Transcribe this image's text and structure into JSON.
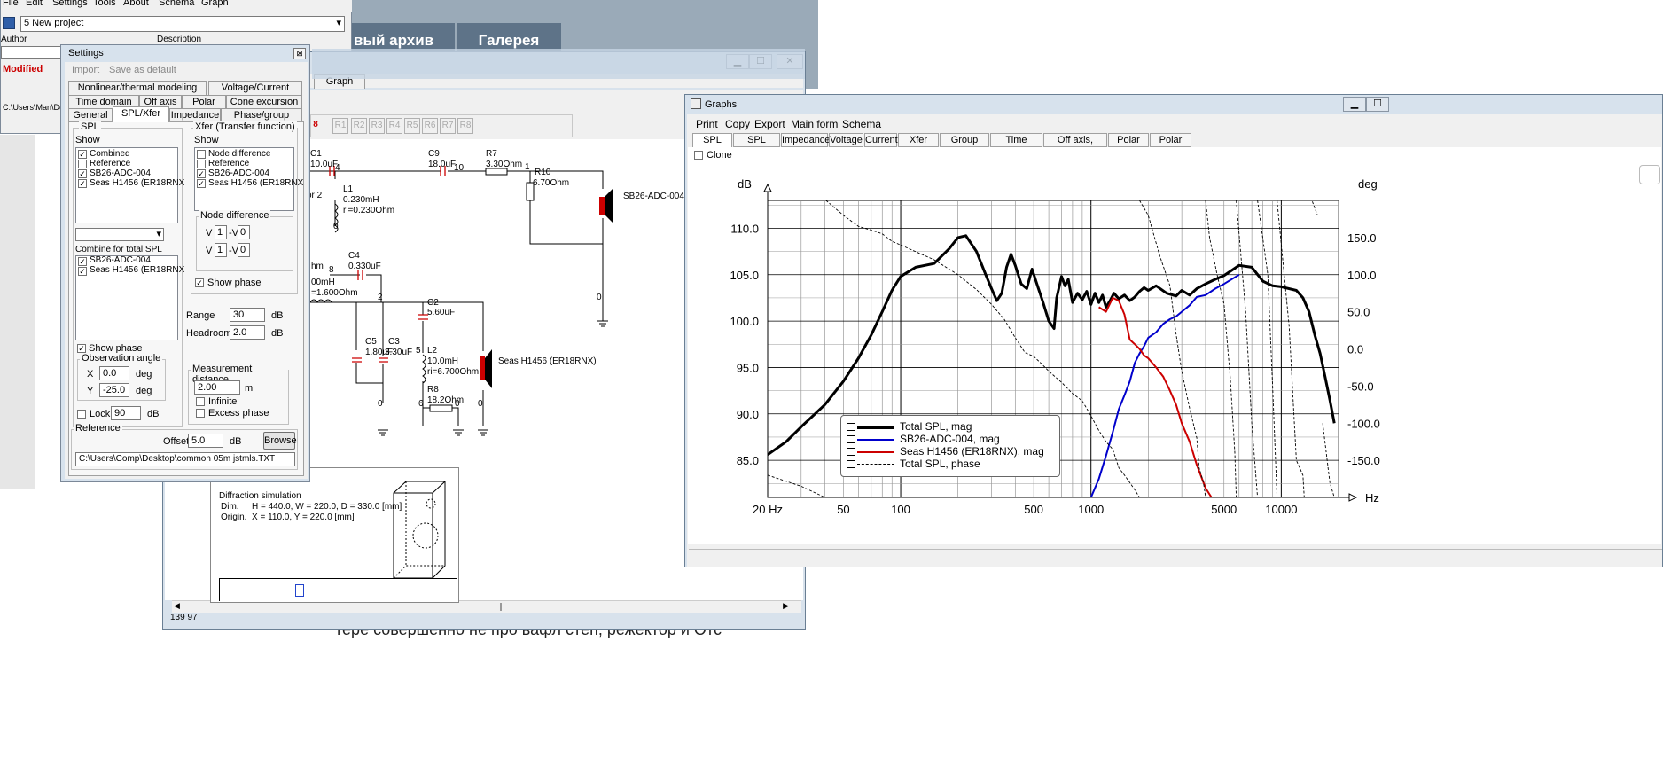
{
  "web": {
    "nav1": "вый архив",
    "nav2": "Галерея",
    "bottom_text": "тере совершенно не про вафл степ, режектор и Отс"
  },
  "main_window": {
    "menu": [
      "File",
      "Edit",
      "Settings",
      "Tools",
      "About",
      "Schema",
      "Graph"
    ],
    "project": "5 New project",
    "author_label": "Author",
    "description_label": "Description",
    "status": "Modified",
    "path": "C:\\Users\\Man\\Desk"
  },
  "schema_window": {
    "tab": "Graph",
    "refs": [
      "8",
      "R1",
      "R2",
      "R3",
      "R4",
      "R5",
      "R6",
      "R7",
      "R8"
    ],
    "statusbar": "139  97",
    "components": {
      "c1": "C1",
      "c1_val": "10.0uF",
      "l1": "L1",
      "l1_val": "0.230mH",
      "l1_ri": "ri=0.230Ohm",
      "c9": "C9",
      "c9_val": "18.0uF",
      "r7": "R7",
      "r7_val": "3.30Ohm",
      "r10": "R10",
      "r10_val": "6.70Ohm",
      "spk1": "SB26-ADC-004",
      "c4": "C4",
      "c4_val": "0.330uF",
      "c2": "C2",
      "c2_val": "5.60uF",
      "c5": "C5",
      "c5_val": "1.80uF",
      "c3": "C3",
      "c3_val": "3.30uF",
      "l2": "L2",
      "l2_val": "10.0mH",
      "l2_ri": "ri=6.700Ohm",
      "r8": "R8",
      "r8_val": "18.2Ohm",
      "spk2": "Seas H1456 (ER18RNX)",
      "left1": "or 2",
      "left2": "hm",
      "left3": "00mH",
      "left4": "=1.600Ohm",
      "nodes": [
        "4",
        "10",
        "1",
        "0",
        "8",
        "2",
        "5",
        "6",
        "0",
        "0",
        "0"
      ]
    },
    "diffraction": {
      "title": "Diffraction simulation",
      "dim_label": "Dim.",
      "dim_value": "H = 440.0, W = 220.0, D = 330.0 [mm]",
      "origin_label": "Origin.",
      "origin_value": "X = 110.0, Y = 220.0 [mm]"
    }
  },
  "settings": {
    "title": "Settings",
    "menu": [
      "Import",
      "Save as default"
    ],
    "tabs_row1": [
      "Nonlinear/thermal modeling",
      "Voltage/Current"
    ],
    "tabs_row2": [
      "Time domain",
      "Off axis",
      "Polar",
      "Cone excursion"
    ],
    "tabs_row3": [
      "General",
      "SPL/Xfer",
      "Impedance",
      "Phase/group delay"
    ],
    "spl": {
      "title": "SPL",
      "show": "Show",
      "items": [
        {
          "label": "Combined",
          "checked": true
        },
        {
          "label": "Reference",
          "checked": false
        },
        {
          "label": "SB26-ADC-004",
          "checked": true
        },
        {
          "label": "Seas H1456 (ER18RNX",
          "checked": true
        }
      ],
      "combine_label": "Combine for total SPL",
      "combine_items": [
        {
          "label": "SB26-ADC-004",
          "checked": true
        },
        {
          "label": "Seas H1456 (ER18RNX",
          "checked": true
        }
      ],
      "show_phase": "Show phase",
      "obs_title": "Observation angle",
      "x_label": "X",
      "x_value": "0.0",
      "x_unit": "deg",
      "y_label": "Y",
      "y_value": "-25.0",
      "y_unit": "deg",
      "lock_label": "Lock",
      "lock_value": "90",
      "lock_unit": "dB"
    },
    "xfer": {
      "title": "Xfer (Transfer function)",
      "show": "Show",
      "items": [
        {
          "label": "Node difference",
          "checked": false
        },
        {
          "label": "Reference",
          "checked": false
        },
        {
          "label": "SB26-ADC-004",
          "checked": true
        },
        {
          "label": "Seas H1456 (ER18RNX",
          "checked": true
        }
      ],
      "node_diff_title": "Node difference",
      "v_label": "V",
      "minus_v": "-V",
      "row1": [
        "1",
        "0"
      ],
      "row2": [
        "1",
        "0"
      ],
      "show_phase": "Show phase"
    },
    "range_label": "Range",
    "range_value": "30",
    "range_unit": "dB",
    "headroom_label": "Headroom",
    "headroom_value": "2.0",
    "headroom_unit": "dB",
    "meas_title": "Measurement distance",
    "meas_value": "2.00",
    "meas_unit": "m",
    "infinite": "Infinite",
    "excess": "Excess phase",
    "reference_title": "Reference",
    "offset_label": "Offset",
    "offset_value": "5.0",
    "offset_unit": "dB",
    "browse": "Browse",
    "ref_path": "C:\\Users\\Comp\\Desktop\\common 05m jstmls.TXT"
  },
  "graphs": {
    "title": "Graphs",
    "menu": [
      "Print",
      "Copy",
      "Export",
      "Main form",
      "Schema"
    ],
    "tabs": [
      "SPL mag",
      "SPL phase",
      "Impedance",
      "Voltage",
      "Current",
      "Xfer func",
      "Group delay",
      "Time domain",
      "Off axis, overlay",
      "Polar plot",
      "Polar map"
    ],
    "clone": "Clone"
  },
  "chart_data": {
    "type": "line",
    "xscale": "log",
    "xlabel": "Hz",
    "ylabel": "dB",
    "y2label": "deg",
    "xlim": [
      20,
      20000
    ],
    "ylim": [
      81,
      113
    ],
    "y2lim": [
      -200,
      200
    ],
    "x_ticks": [
      "20 Hz",
      "50",
      "100",
      "500",
      "1000",
      "5000",
      "10000"
    ],
    "x_tick_values": [
      20,
      50,
      100,
      500,
      1000,
      5000,
      10000
    ],
    "y_ticks": [
      85.0,
      90.0,
      95.0,
      100.0,
      105.0,
      110.0
    ],
    "y_tick_labels": [
      "85.0",
      "90.0",
      "95.0",
      "100.0",
      "105.0",
      "110.0"
    ],
    "y2_ticks": [
      -150,
      -100,
      -50,
      0,
      50,
      100,
      150
    ],
    "y2_tick_labels": [
      "-150.0",
      "-100.0",
      "-50.0",
      "0.0",
      "50.0",
      "100.0",
      "150.0"
    ],
    "grid": true,
    "legend_position": "bottom-left",
    "series": [
      {
        "name": "Total SPL, mag",
        "color": "#000000",
        "axis": "left",
        "points": [
          [
            20,
            85.6
          ],
          [
            25,
            87
          ],
          [
            30,
            88.6
          ],
          [
            40,
            91
          ],
          [
            50,
            93.5
          ],
          [
            60,
            96
          ],
          [
            70,
            98.5
          ],
          [
            80,
            101
          ],
          [
            90,
            103.3
          ],
          [
            100,
            104.8
          ],
          [
            120,
            105.8
          ],
          [
            150,
            106.2
          ],
          [
            180,
            107.8
          ],
          [
            200,
            109
          ],
          [
            220,
            109.2
          ],
          [
            250,
            107.5
          ],
          [
            280,
            105
          ],
          [
            300,
            103.5
          ],
          [
            320,
            102.2
          ],
          [
            340,
            103
          ],
          [
            360,
            105.8
          ],
          [
            380,
            107.2
          ],
          [
            400,
            106
          ],
          [
            430,
            104
          ],
          [
            460,
            103.5
          ],
          [
            490,
            105.6
          ],
          [
            520,
            104
          ],
          [
            560,
            102
          ],
          [
            600,
            100
          ],
          [
            640,
            99.2
          ],
          [
            660,
            102.5
          ],
          [
            700,
            104.8
          ],
          [
            730,
            103.8
          ],
          [
            760,
            104.5
          ],
          [
            800,
            102
          ],
          [
            850,
            103
          ],
          [
            900,
            102.3
          ],
          [
            950,
            103.2
          ],
          [
            1000,
            101.8
          ],
          [
            1050,
            103
          ],
          [
            1100,
            102
          ],
          [
            1150,
            102.8
          ],
          [
            1200,
            101.5
          ],
          [
            1260,
            102.2
          ],
          [
            1320,
            103
          ],
          [
            1400,
            102.4
          ],
          [
            1500,
            102.8
          ],
          [
            1600,
            102.2
          ],
          [
            1700,
            102.6
          ],
          [
            1800,
            103.2
          ],
          [
            1900,
            103.6
          ],
          [
            2000,
            103.3
          ],
          [
            2200,
            103.8
          ],
          [
            2500,
            103
          ],
          [
            2800,
            102.7
          ],
          [
            3000,
            103.3
          ],
          [
            3300,
            102.8
          ],
          [
            3600,
            103.5
          ],
          [
            4000,
            104
          ],
          [
            4500,
            104.5
          ],
          [
            5000,
            104.9
          ],
          [
            6000,
            106
          ],
          [
            7000,
            105.8
          ],
          [
            8000,
            104.3
          ],
          [
            9000,
            103.8
          ],
          [
            10000,
            103.7
          ],
          [
            12000,
            103.3
          ],
          [
            13000,
            102.5
          ],
          [
            14000,
            101
          ],
          [
            15000,
            98.5
          ],
          [
            16000,
            96.5
          ],
          [
            17000,
            94
          ],
          [
            18000,
            91.5
          ],
          [
            19000,
            89
          ]
        ]
      },
      {
        "name": "SB26-ADC-004, mag",
        "color": "#0000cc",
        "axis": "left",
        "points": [
          [
            1000,
            81
          ],
          [
            1100,
            83
          ],
          [
            1200,
            85.5
          ],
          [
            1300,
            88
          ],
          [
            1400,
            90.5
          ],
          [
            1500,
            92
          ],
          [
            1600,
            93.5
          ],
          [
            1700,
            95.5
          ],
          [
            1800,
            96.5
          ],
          [
            1900,
            97.3
          ],
          [
            2000,
            98.2
          ],
          [
            2200,
            98.8
          ],
          [
            2400,
            99.7
          ],
          [
            2600,
            100.2
          ],
          [
            2800,
            100.5
          ],
          [
            3000,
            101
          ],
          [
            3300,
            101.7
          ],
          [
            3600,
            102.6
          ],
          [
            4000,
            102.8
          ],
          [
            4500,
            103.5
          ],
          [
            5000,
            104
          ],
          [
            6000,
            105
          ]
        ]
      },
      {
        "name": "Seas H1456 (ER18RNX), mag",
        "color": "#cc0000",
        "axis": "left",
        "points": [
          [
            1100,
            101.5
          ],
          [
            1200,
            101
          ],
          [
            1300,
            102.5
          ],
          [
            1400,
            102.2
          ],
          [
            1500,
            100.7
          ],
          [
            1600,
            98
          ],
          [
            1700,
            97.5
          ],
          [
            1800,
            97
          ],
          [
            1900,
            96.3
          ],
          [
            2000,
            96
          ],
          [
            2200,
            95
          ],
          [
            2400,
            94
          ],
          [
            2600,
            92.5
          ],
          [
            2800,
            91
          ],
          [
            3000,
            89
          ],
          [
            3300,
            87
          ],
          [
            3600,
            84.5
          ],
          [
            4000,
            82
          ],
          [
            4300,
            81
          ]
        ]
      },
      {
        "name": "Total SPL, phase",
        "color": "#000000",
        "dashed": true,
        "axis": "right",
        "points": [
          [
            20,
            -170
          ],
          [
            30,
            -185
          ],
          [
            40,
            -200
          ],
          [
            40.5,
            200
          ],
          [
            50,
            180
          ],
          [
            60,
            165
          ],
          [
            70,
            160
          ],
          [
            80,
            155
          ],
          [
            90,
            145
          ],
          [
            100,
            140
          ],
          [
            150,
            120
          ],
          [
            200,
            100
          ],
          [
            250,
            80
          ],
          [
            300,
            60
          ],
          [
            350,
            40
          ],
          [
            400,
            15
          ],
          [
            450,
            -5
          ],
          [
            500,
            -10
          ],
          [
            550,
            -20
          ],
          [
            600,
            -30
          ],
          [
            700,
            -45
          ],
          [
            800,
            -60
          ],
          [
            900,
            -70
          ],
          [
            1000,
            -90
          ],
          [
            1100,
            -110
          ],
          [
            1200,
            -125
          ],
          [
            1300,
            -135
          ],
          [
            1400,
            -160
          ],
          [
            1500,
            -170
          ],
          [
            1600,
            -180
          ],
          [
            1700,
            -190
          ],
          [
            1800,
            -200
          ],
          [
            1800.5,
            200
          ],
          [
            2000,
            180
          ],
          [
            2300,
            125
          ],
          [
            2600,
            85
          ],
          [
            2800,
            20
          ],
          [
            3000,
            -30
          ],
          [
            3300,
            -80
          ],
          [
            3600,
            -120
          ],
          [
            3700,
            -160
          ],
          [
            3800,
            -170
          ],
          [
            3900,
            -180
          ],
          [
            4000,
            -200
          ],
          [
            4000.5,
            200
          ],
          [
            4200,
            150
          ],
          [
            4600,
            100
          ],
          [
            5000,
            60
          ],
          [
            5400,
            -40
          ],
          [
            5700,
            -140
          ],
          [
            5800,
            -200
          ],
          [
            5800.5,
            200
          ],
          [
            6500,
            50
          ],
          [
            7000,
            -100
          ],
          [
            7500,
            -200
          ],
          [
            7500.5,
            200
          ],
          [
            8500,
            100
          ],
          [
            9000,
            -50
          ],
          [
            9500,
            -200
          ],
          [
            9500.5,
            200
          ],
          [
            11000,
            30
          ],
          [
            12000,
            -150
          ],
          [
            13000,
            -170
          ],
          [
            13200,
            -200
          ],
          [
            13200.5,
            200
          ],
          [
            14500,
            200
          ],
          [
            15500,
            180
          ],
          [
            16500,
            -100
          ],
          [
            18000,
            -180
          ],
          [
            19000,
            -200
          ]
        ]
      }
    ]
  }
}
